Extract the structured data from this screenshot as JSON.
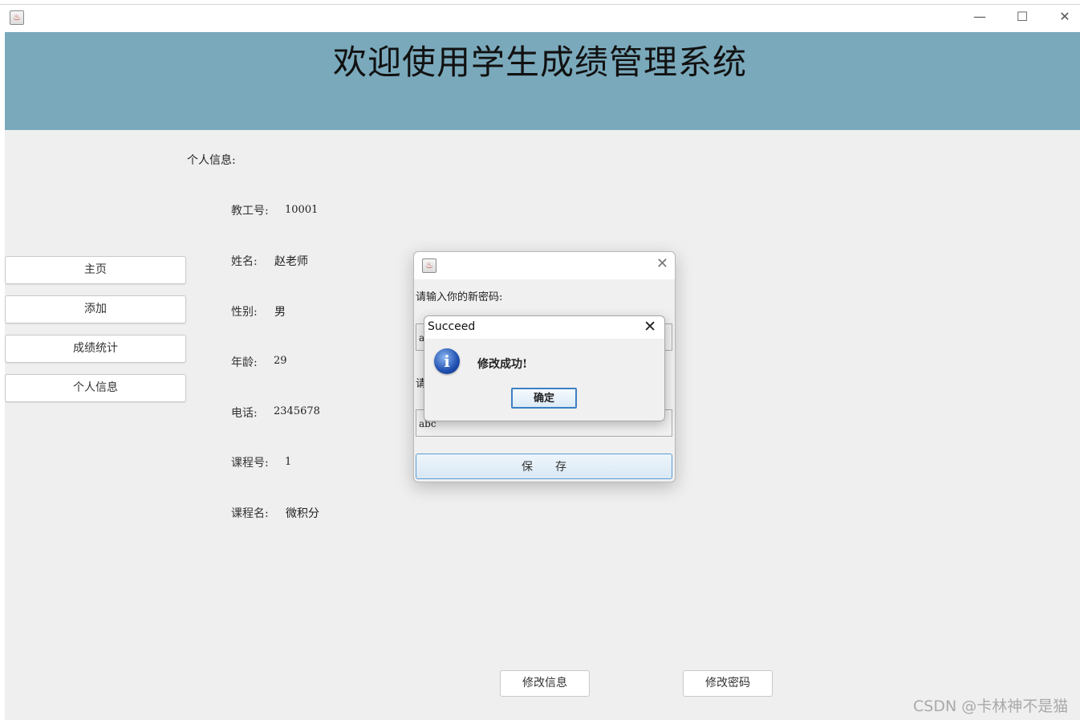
{
  "window": {
    "app_icon": "java-cup-icon"
  },
  "controls": {
    "minimize": "—",
    "maximize": "☐",
    "close": "✕"
  },
  "banner": {
    "title": "欢迎使用学生成绩管理系统"
  },
  "section": {
    "title": "个人信息:"
  },
  "info": [
    {
      "label": "教工号:",
      "value": "10001"
    },
    {
      "label": "姓名:",
      "value": "赵老师"
    },
    {
      "label": "性别:",
      "value": "男"
    },
    {
      "label": "年龄:",
      "value": "29"
    },
    {
      "label": "电话:",
      "value": "2345678"
    },
    {
      "label": "课程号:",
      "value": "1"
    },
    {
      "label": "课程名:",
      "value": "微积分"
    }
  ],
  "nav": [
    "主页",
    "添加",
    "成绩统计",
    "个人信息"
  ],
  "bottom_buttons": {
    "edit_info": "修改信息",
    "change_password": "修改密码"
  },
  "password_dialog": {
    "close": "✕",
    "new_password_label": "请输入你的新密码:",
    "new_password_value": "a",
    "confirm_label": "请",
    "confirm_value": "abc",
    "save": "保存"
  },
  "message_dialog": {
    "title": "Succeed",
    "close": "✕",
    "icon": "i",
    "text": "修改成功!",
    "ok": "确定"
  },
  "watermark": "CSDN @卡林神不是猫",
  "colors": {
    "banner": "#7aa9bb",
    "content_bg": "#efefef",
    "accent": "#3c7fc4"
  }
}
